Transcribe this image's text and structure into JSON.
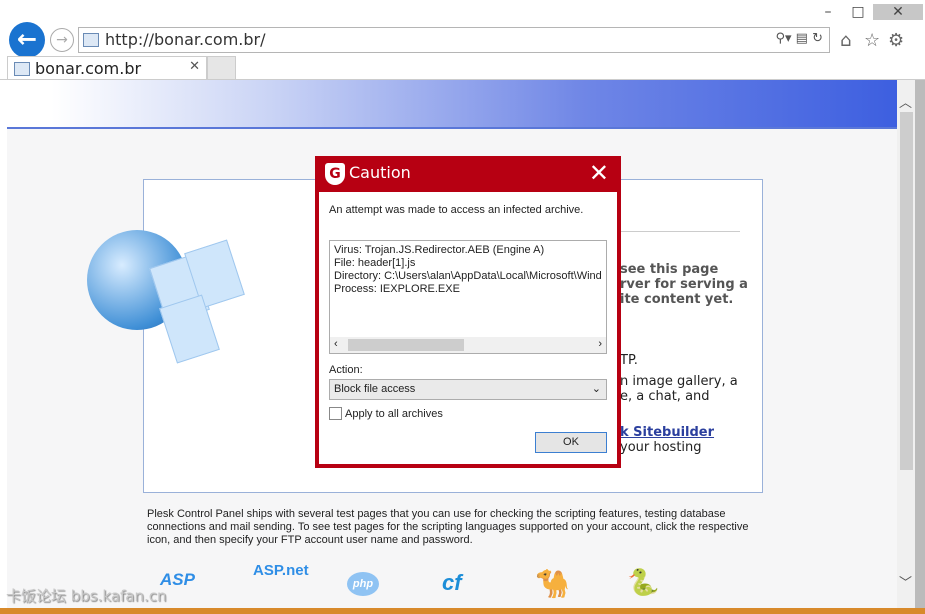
{
  "browser": {
    "url": "http://bonar.com.br/",
    "tab_title": "bonar.com.br",
    "icons": [
      "back-icon",
      "forward-icon",
      "search-icon",
      "compat-icon",
      "refresh-icon",
      "home-icon",
      "star-icon",
      "gear-icon",
      "minimize-icon",
      "maximize-icon",
      "close-icon"
    ]
  },
  "page": {
    "fragments": [
      "see this page",
      "rver for serving a",
      "ite content yet.",
      "TP.",
      "n image gallery, a",
      "e, a chat, and",
      "k Sitebuilder",
      "your hosting"
    ],
    "plesk_text": "Plesk Control Panel ships with several test pages that you can use for checking the scripting features, testing database connections and mail sending. To see test pages for the scripting languages supported on your account, click the respective icon, and then specify your FTP account user name and password.",
    "languages": [
      "ASP",
      "ASP.net",
      "php",
      "ColdFusion",
      "Perl",
      "Python"
    ]
  },
  "dialog": {
    "title": "Caution",
    "message": "An attempt was made to access an infected archive.",
    "details": [
      "Virus: Trojan.JS.Redirector.AEB (Engine A)",
      "File: header[1].js",
      "Directory: C:\\Users\\alan\\AppData\\Local\\Microsoft\\Wind",
      "Process: IEXPLORE.EXE"
    ],
    "action_label": "Action:",
    "action_value": "Block file access",
    "apply_all_label": "Apply to all archives",
    "apply_all_checked": false,
    "ok_label": "OK",
    "accent": "#b70012"
  },
  "watermark": "卡饭论坛 bbs.kafan.cn"
}
